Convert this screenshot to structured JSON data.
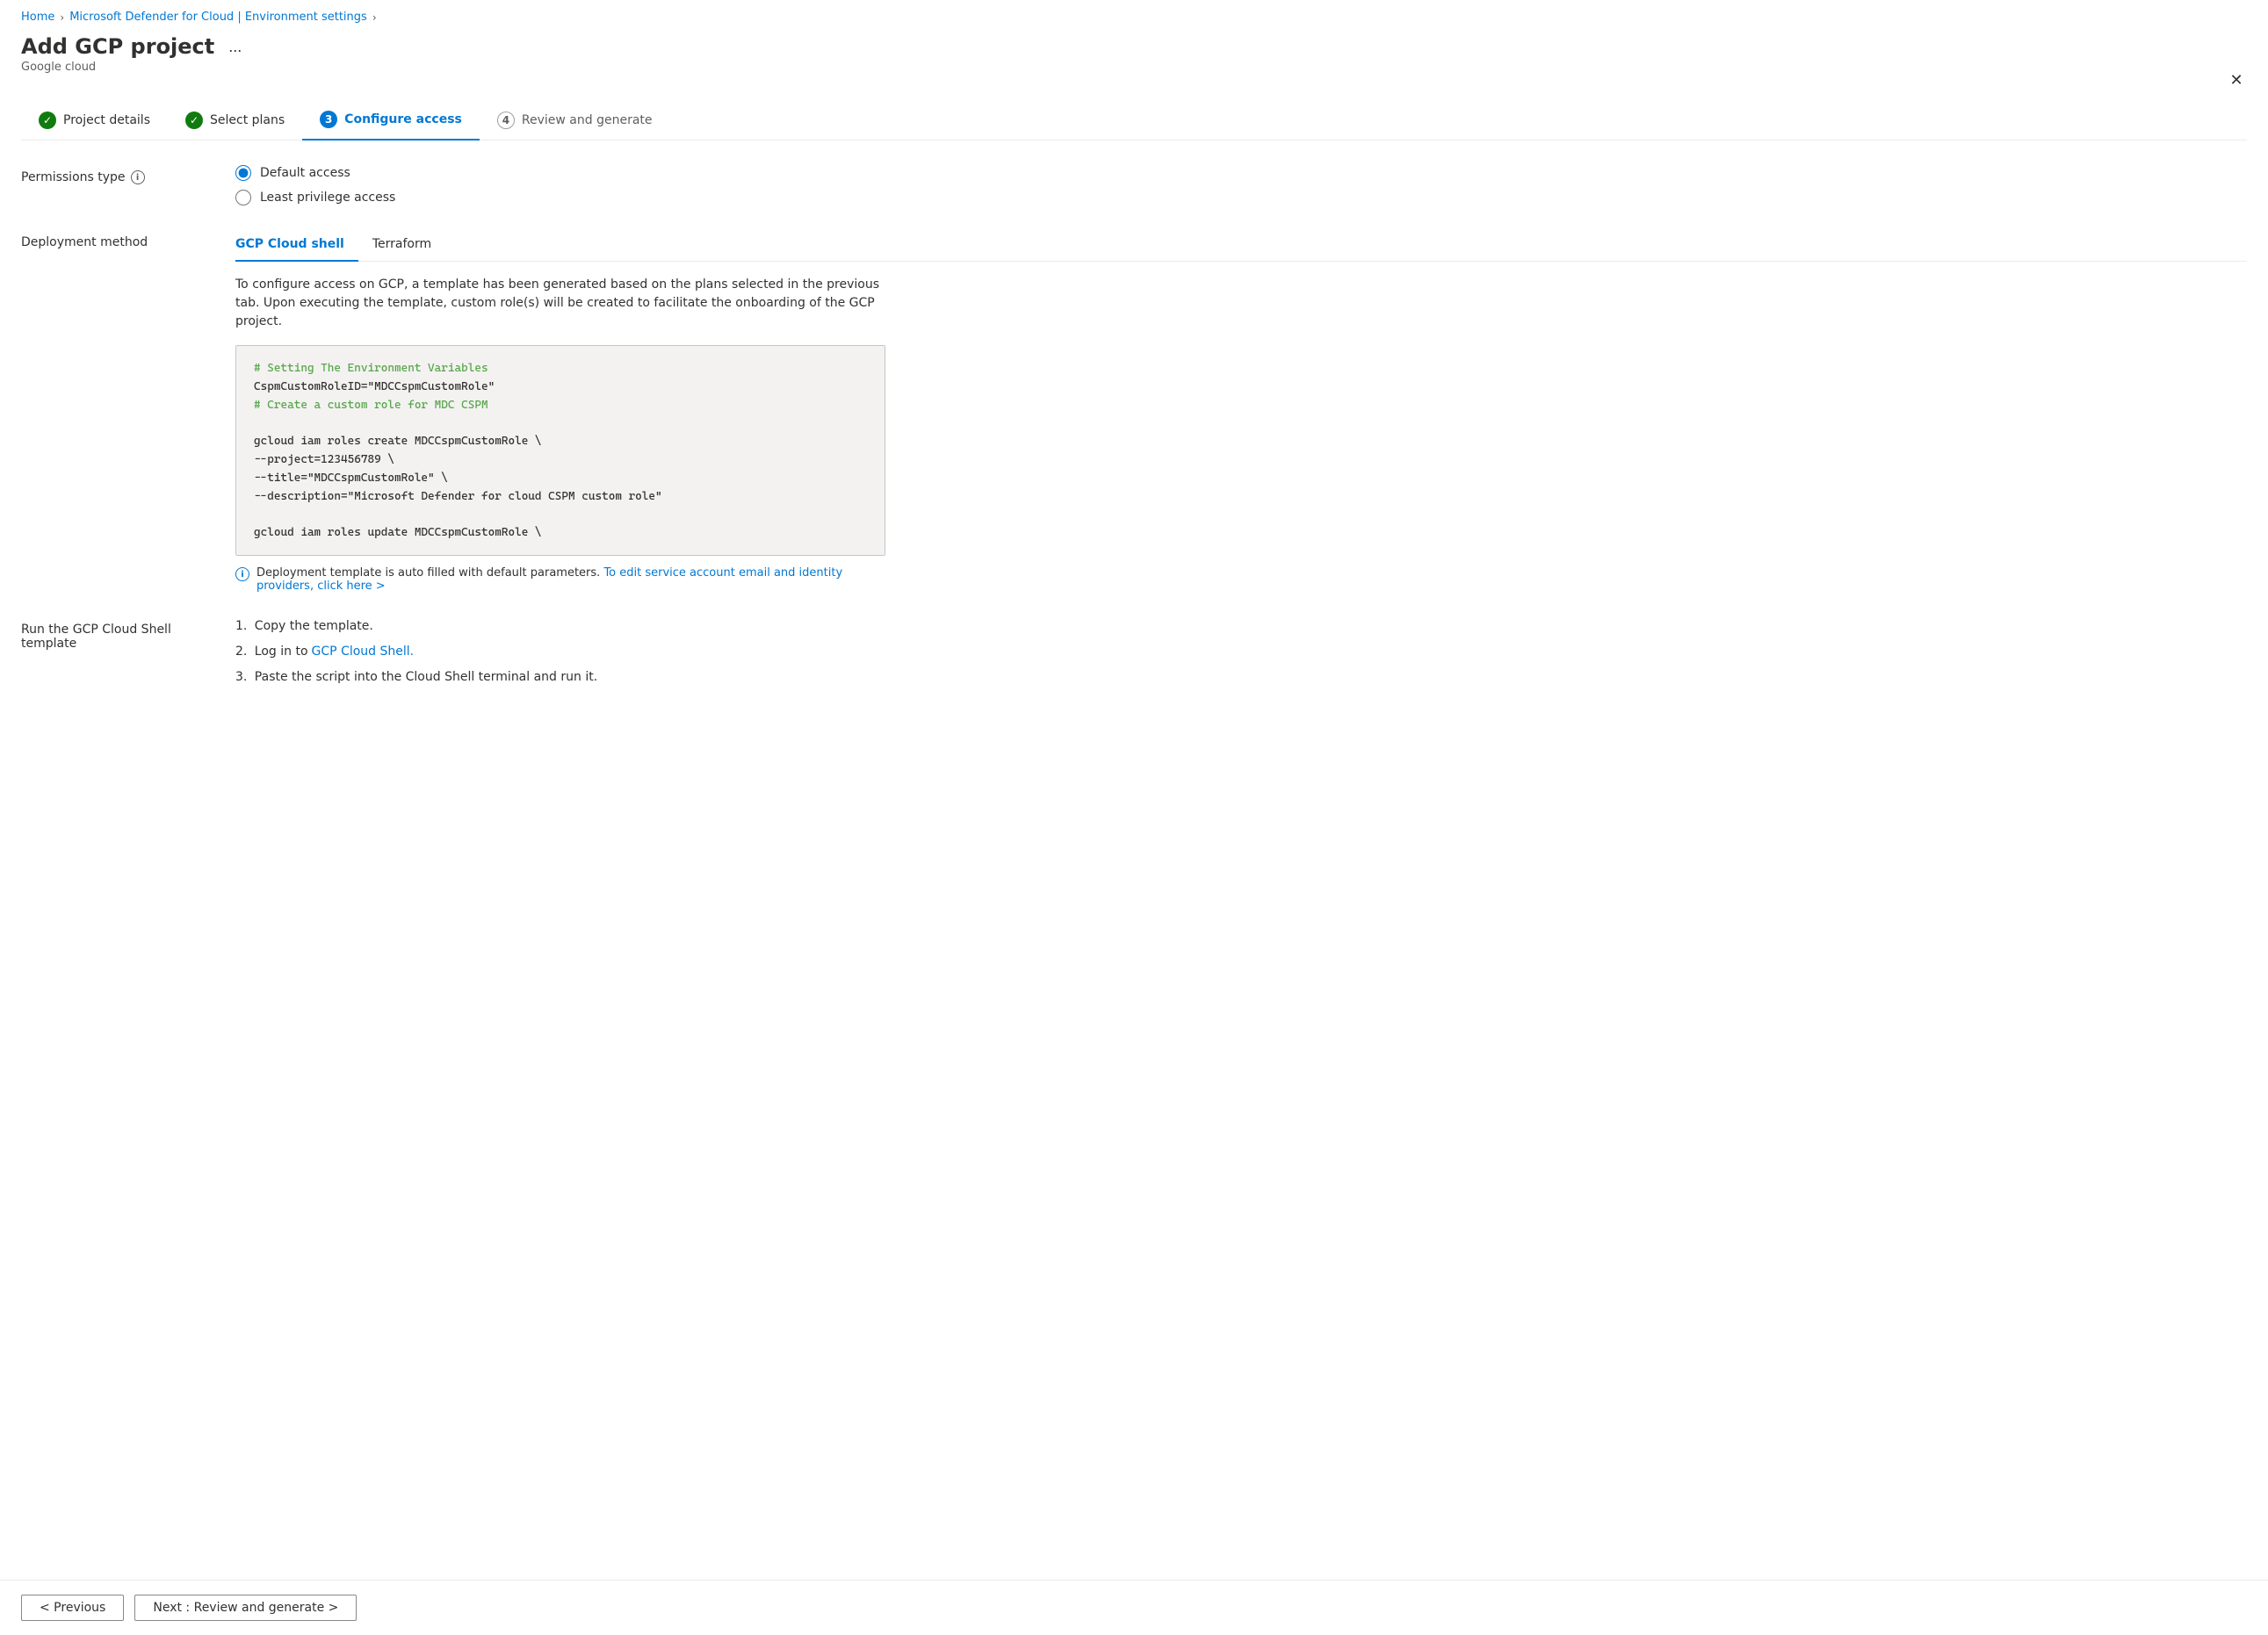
{
  "breadcrumb": {
    "items": [
      {
        "label": "Home",
        "link": true
      },
      {
        "label": "Microsoft Defender for Cloud | Environment settings",
        "link": true
      }
    ],
    "separator": ">"
  },
  "page": {
    "title": "Add GCP project",
    "subtitle": "Google cloud",
    "ellipsis_label": "..."
  },
  "close_button_label": "✕",
  "steps": [
    {
      "id": "project-details",
      "number": "✓",
      "label": "Project details",
      "state": "completed"
    },
    {
      "id": "select-plans",
      "number": "✓",
      "label": "Select plans",
      "state": "completed"
    },
    {
      "id": "configure-access",
      "number": "3",
      "label": "Configure access",
      "state": "active"
    },
    {
      "id": "review-generate",
      "number": "4",
      "label": "Review and generate",
      "state": "pending"
    }
  ],
  "form": {
    "permissions_type": {
      "label": "Permissions type",
      "info_tooltip": "i",
      "options": [
        {
          "id": "default-access",
          "label": "Default access",
          "checked": true
        },
        {
          "id": "least-privilege",
          "label": "Least privilege access",
          "checked": false
        }
      ]
    },
    "deployment_method": {
      "label": "Deployment method",
      "tabs": [
        {
          "id": "gcp-cloud-shell",
          "label": "GCP Cloud shell",
          "active": true
        },
        {
          "id": "terraform",
          "label": "Terraform",
          "active": false
        }
      ],
      "description": "To configure access on GCP, a template has been generated based on the plans selected in the previous tab. Upon executing the template, custom role(s) will be created to facilitate the onboarding of the GCP project.",
      "code": {
        "lines": [
          {
            "type": "comment",
            "text": "# Setting The Environment Variables"
          },
          {
            "type": "normal",
            "text": "CspmCustomRoleID=\"MDCCspmCustomRole\""
          },
          {
            "type": "comment",
            "text": "# Create a custom role for MDC CSPM"
          },
          {
            "type": "blank",
            "text": ""
          },
          {
            "type": "normal",
            "text": "gcloud iam roles create MDCCspmCustomRole \\"
          },
          {
            "type": "normal",
            "text": "--project=123456789 \\"
          },
          {
            "type": "normal",
            "text": "--title=\"MDCCspmCustomRole\" \\"
          },
          {
            "type": "normal",
            "text": "--description=\"Microsoft Defender for cloud CSPM custom role\""
          },
          {
            "type": "blank",
            "text": ""
          },
          {
            "type": "normal",
            "text": "gcloud iam roles update MDCCspmCustomRole \\"
          }
        ]
      },
      "info_bar": {
        "icon": "i",
        "text": "Deployment template is auto filled with default parameters.",
        "link_text": "To edit service account email and identity providers, click here >"
      }
    },
    "run_cloud_shell": {
      "label_line1": "Run the GCP Cloud Shell",
      "label_line2": "template",
      "steps": [
        {
          "number": "1.",
          "text": "Copy the template."
        },
        {
          "number": "2.",
          "text": "Log in to ",
          "link": "GCP Cloud Shell.",
          "link_href": "#"
        },
        {
          "number": "3.",
          "text": "Paste the script into the Cloud Shell terminal and run it."
        }
      ]
    }
  },
  "footer": {
    "previous_label": "< Previous",
    "next_label": "Next : Review and generate >"
  }
}
